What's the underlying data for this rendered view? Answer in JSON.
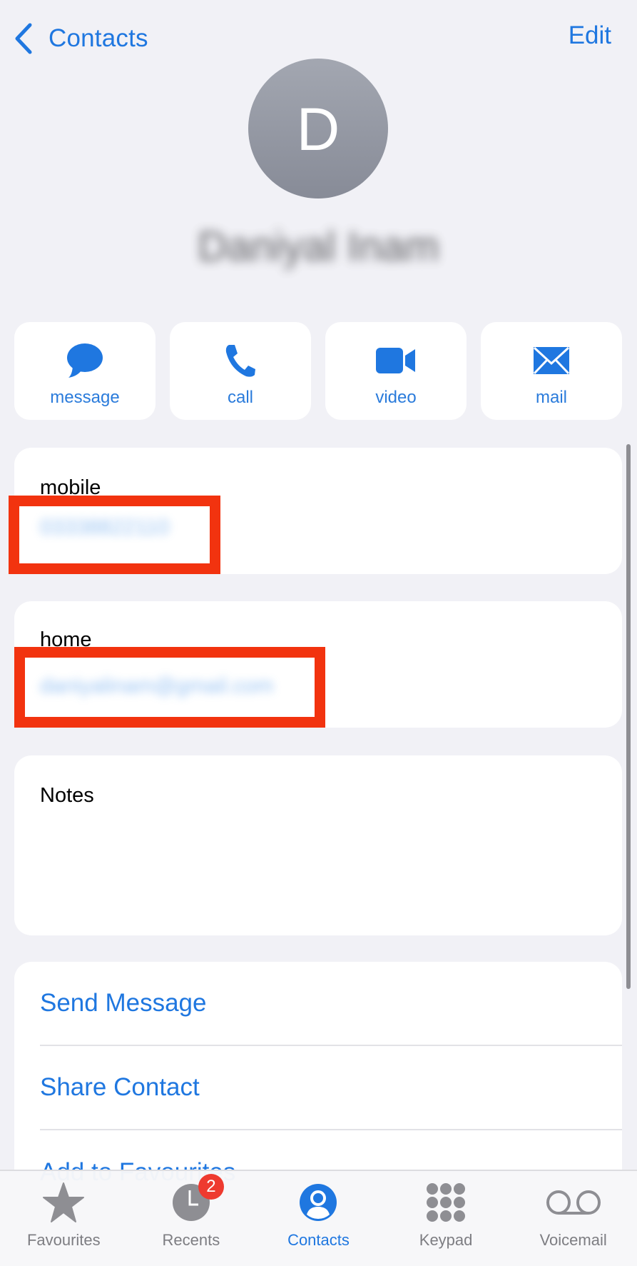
{
  "nav": {
    "back_label": "Contacts",
    "edit_label": "Edit"
  },
  "contact": {
    "initial": "D",
    "name": "Daniyal Inam"
  },
  "quick_actions": [
    {
      "label": "message",
      "icon": "message-bubble-icon"
    },
    {
      "label": "call",
      "icon": "phone-icon"
    },
    {
      "label": "video",
      "icon": "video-camera-icon"
    },
    {
      "label": "mail",
      "icon": "envelope-icon"
    }
  ],
  "fields": {
    "mobile": {
      "label": "mobile",
      "value": "03338822110"
    },
    "home": {
      "label": "home",
      "value": "daniyalinam@gmail.com"
    },
    "notes": {
      "label": "Notes",
      "value": ""
    }
  },
  "action_list": [
    {
      "label": "Send Message"
    },
    {
      "label": "Share Contact"
    },
    {
      "label": "Add to Favourites"
    }
  ],
  "tabbar": {
    "tabs": [
      {
        "label": "Favourites",
        "icon": "star-icon",
        "active": false
      },
      {
        "label": "Recents",
        "icon": "clock-icon",
        "active": false,
        "badge": "2"
      },
      {
        "label": "Contacts",
        "icon": "person-circle-icon",
        "active": true
      },
      {
        "label": "Keypad",
        "icon": "keypad-icon",
        "active": false
      },
      {
        "label": "Voicemail",
        "icon": "voicemail-icon",
        "active": false
      }
    ]
  },
  "colors": {
    "accent": "#1f77e0",
    "background": "#f1f1f6",
    "highlight": "#f2330f",
    "badge": "#ee3a2f",
    "inactive_tab": "#7d7d82"
  }
}
